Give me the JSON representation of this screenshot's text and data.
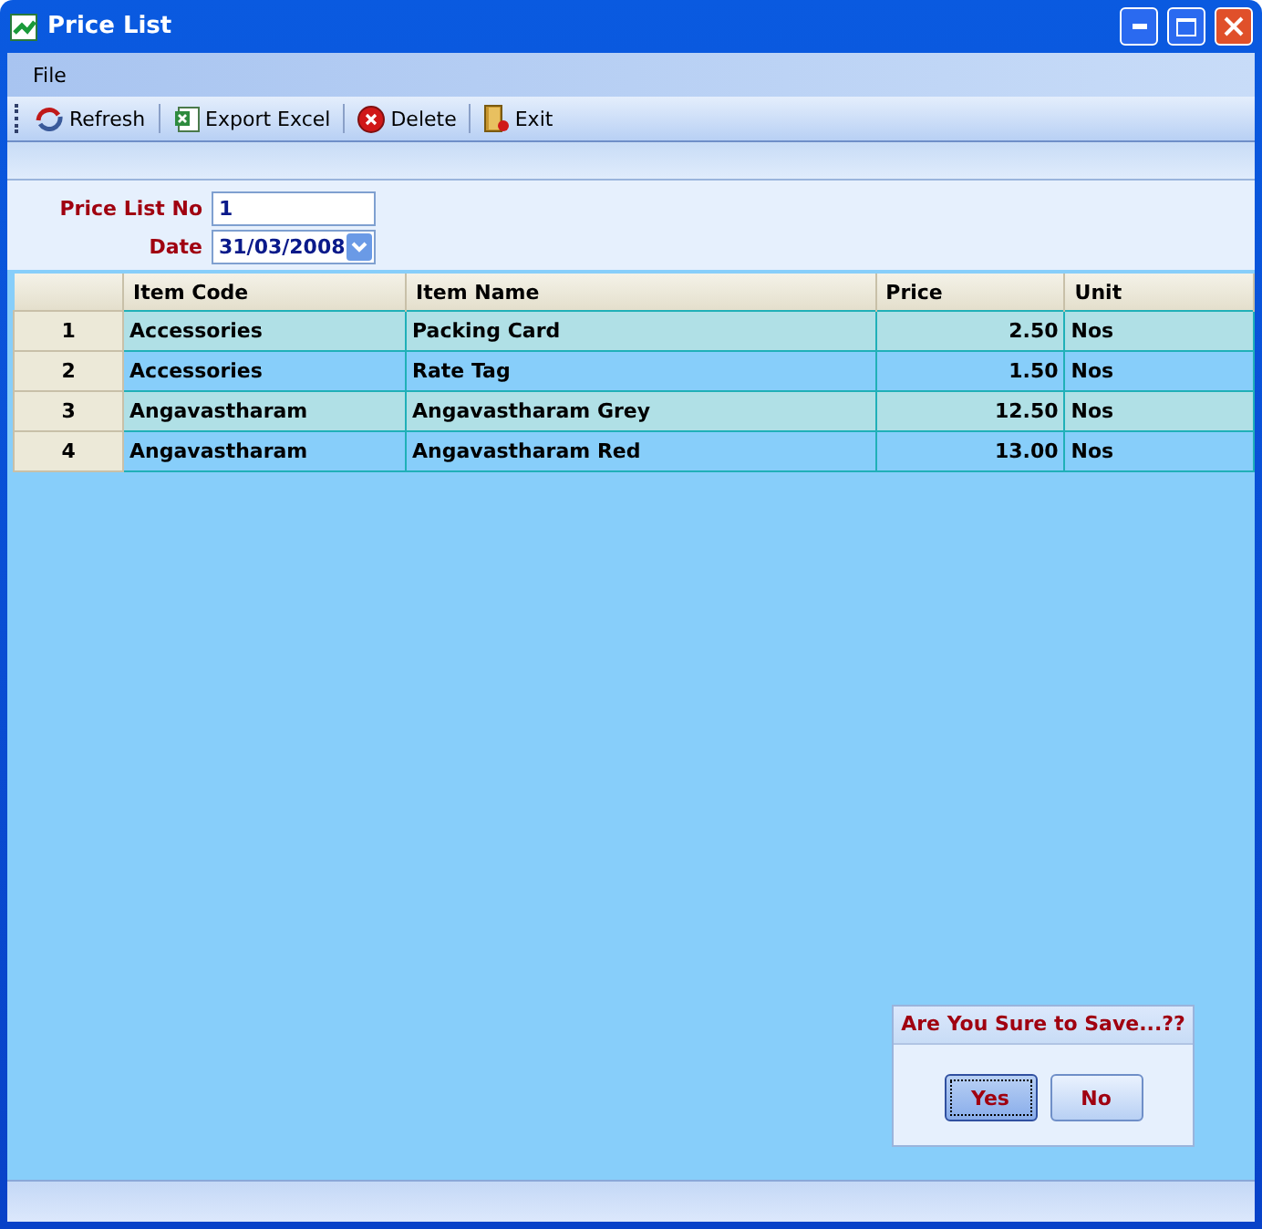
{
  "window": {
    "title": "Price List"
  },
  "menu": [
    "File"
  ],
  "toolbar": [
    {
      "kind": "refresh",
      "label": "Refresh"
    },
    {
      "kind": "excel",
      "label": "Export Excel"
    },
    {
      "kind": "delete",
      "label": "Delete"
    },
    {
      "kind": "exit",
      "label": "Exit"
    }
  ],
  "form": {
    "price_list_no": {
      "label": "Price List No",
      "value": "1"
    },
    "date": {
      "label": "Date",
      "value": "31/03/2008"
    }
  },
  "table": {
    "columns": [
      "Item Code",
      "Item Name",
      "Price",
      "Unit"
    ],
    "rows": [
      {
        "number": "1",
        "cells": [
          "Accessories",
          "Packing Card",
          "2.50",
          "Nos"
        ]
      },
      {
        "number": "2",
        "cells": [
          "Accessories",
          "Rate Tag",
          "1.50",
          "Nos"
        ]
      },
      {
        "number": "3",
        "cells": [
          "Angavastharam",
          "Angavastharam Grey",
          "12.50",
          "Nos"
        ]
      },
      {
        "number": "4",
        "cells": [
          "Angavastharam",
          "Angavastharam Red",
          "13.00",
          "Nos"
        ]
      }
    ]
  },
  "dialog": {
    "title": "Are You Sure to Save...??",
    "buttons": [
      {
        "label": "Yes",
        "focused": true
      },
      {
        "label": "No",
        "focused": false
      }
    ]
  }
}
